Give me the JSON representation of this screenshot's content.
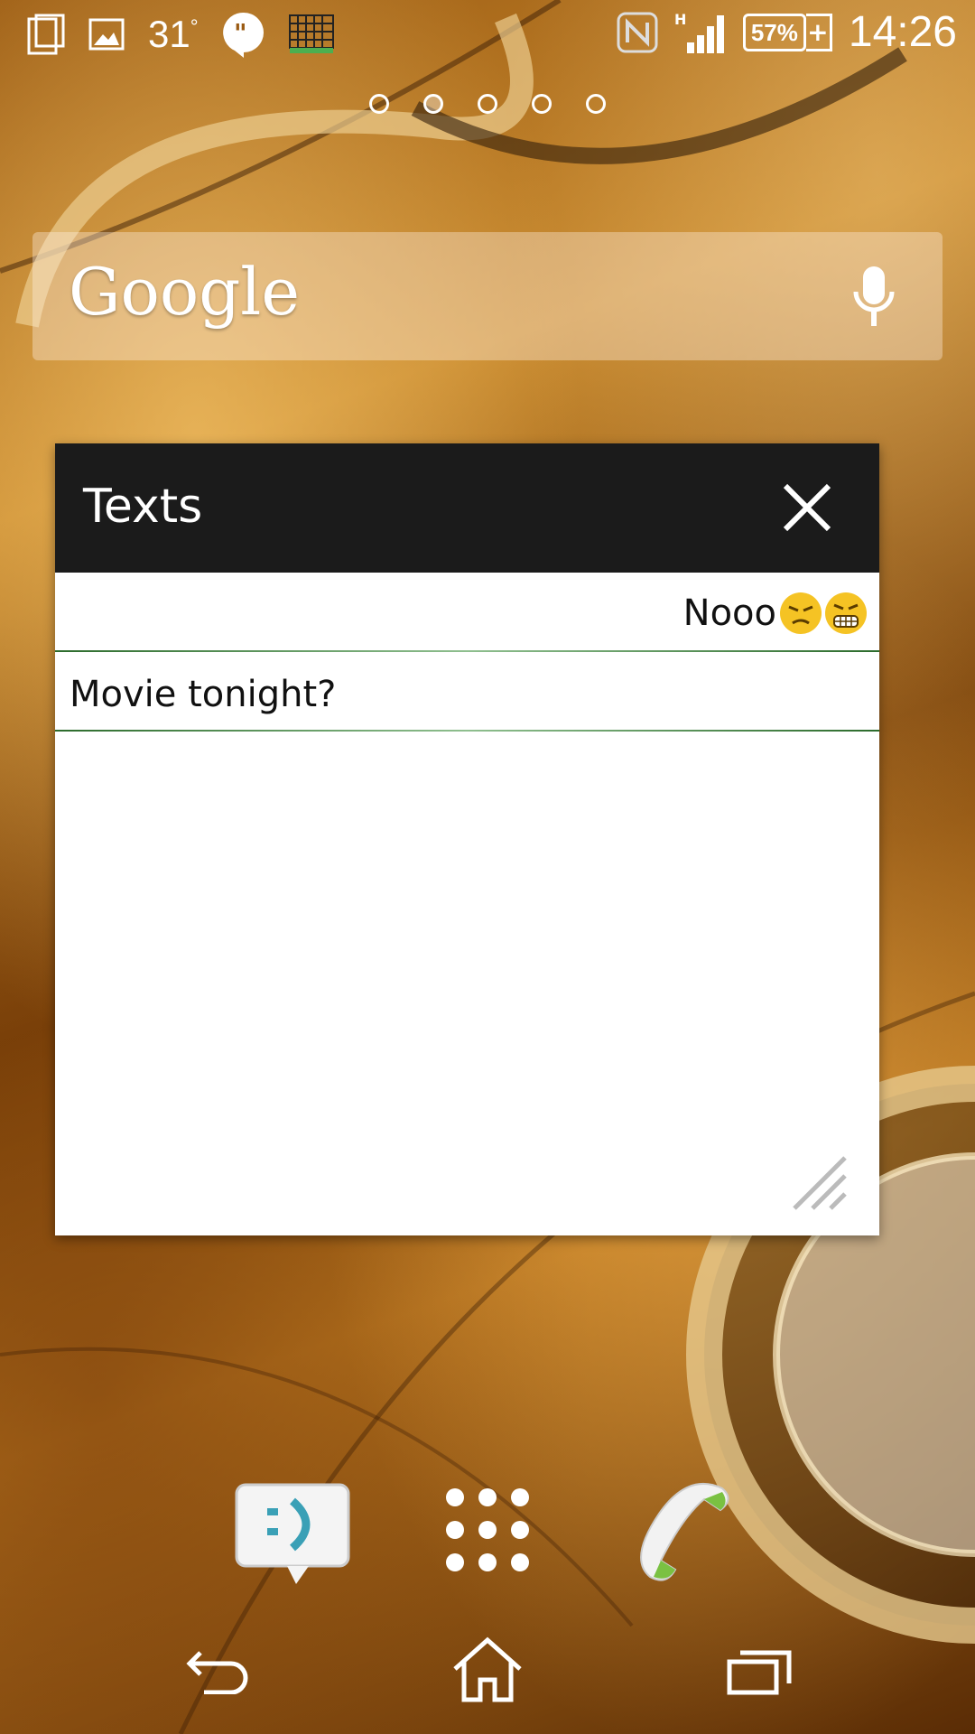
{
  "status_bar": {
    "temperature": "31",
    "degree": "°",
    "battery_percent": "57%",
    "time": "14:26",
    "network_type": "H",
    "icons": [
      "screenshot-icon",
      "gallery-icon",
      "hangouts-icon",
      "calendar-grid-icon",
      "nfc-icon",
      "signal-icon",
      "battery-icon"
    ]
  },
  "home": {
    "page_count": 5,
    "active_page": 2
  },
  "search_bar": {
    "logo": "Google",
    "icon": "mic-icon"
  },
  "widget": {
    "title": "Texts",
    "messages": [
      {
        "direction": "outgoing",
        "text": "Nooo",
        "emoji": [
          "unamused-face",
          "grimacing-face"
        ]
      },
      {
        "direction": "incoming",
        "text": "Movie tonight?"
      }
    ]
  },
  "dock": {
    "apps": [
      "messaging-app-icon",
      "app-drawer-icon",
      "phone-app-icon"
    ]
  },
  "nav_bar": {
    "buttons": [
      "back-icon",
      "home-icon",
      "recents-icon"
    ]
  },
  "colors": {
    "widget_header": "#1b1b1b",
    "divider": "#2c6b2c",
    "emoji": "#f5c324"
  }
}
